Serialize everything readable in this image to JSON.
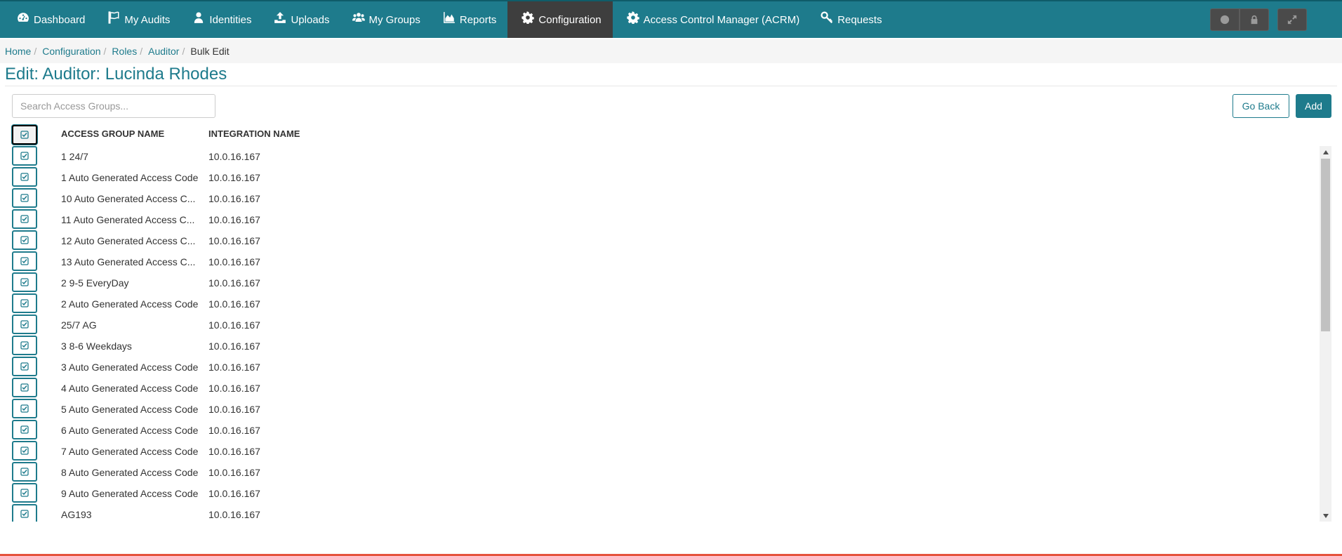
{
  "nav": {
    "items": [
      {
        "label": "Dashboard",
        "icon": "dashboard-icon"
      },
      {
        "label": "My Audits",
        "icon": "flag-icon"
      },
      {
        "label": "Identities",
        "icon": "user-icon"
      },
      {
        "label": "Uploads",
        "icon": "upload-icon"
      },
      {
        "label": "My Groups",
        "icon": "users-icon"
      },
      {
        "label": "Reports",
        "icon": "area-chart-icon"
      },
      {
        "label": "Configuration",
        "icon": "gear-icon",
        "active": true
      },
      {
        "label": "Access Control Manager (ACRM)",
        "icon": "gear-icon"
      },
      {
        "label": "Requests",
        "icon": "key-icon"
      }
    ],
    "right_buttons": [
      "globe-icon",
      "lock-icon",
      "expand-icon"
    ],
    "colors": {
      "bar": "#1e7b8c",
      "active": "#3e3e3e"
    }
  },
  "breadcrumb": [
    "Home",
    "Configuration",
    "Roles",
    "Auditor",
    "Bulk Edit"
  ],
  "page": {
    "title": "Edit: Auditor: Lucinda Rhodes",
    "search_placeholder": "Search Access Groups...",
    "go_back_label": "Go Back",
    "add_label": "Add"
  },
  "table": {
    "columns": [
      "ACCESS GROUP NAME",
      "INTEGRATION NAME"
    ],
    "rows": [
      {
        "name": "1 24/7",
        "integration": "10.0.16.167",
        "checked": true
      },
      {
        "name": "1 Auto Generated Access Code",
        "integration": "10.0.16.167",
        "checked": true
      },
      {
        "name": "10 Auto Generated Access C...",
        "integration": "10.0.16.167",
        "checked": true
      },
      {
        "name": "11 Auto Generated Access C...",
        "integration": "10.0.16.167",
        "checked": true
      },
      {
        "name": "12 Auto Generated Access C...",
        "integration": "10.0.16.167",
        "checked": true
      },
      {
        "name": "13 Auto Generated Access C...",
        "integration": "10.0.16.167",
        "checked": true
      },
      {
        "name": "2 9-5 EveryDay",
        "integration": "10.0.16.167",
        "checked": true
      },
      {
        "name": "2 Auto Generated Access Code",
        "integration": "10.0.16.167",
        "checked": true
      },
      {
        "name": "25/7 AG",
        "integration": "10.0.16.167",
        "checked": true
      },
      {
        "name": "3 8-6 Weekdays",
        "integration": "10.0.16.167",
        "checked": true
      },
      {
        "name": "3 Auto Generated Access Code",
        "integration": "10.0.16.167",
        "checked": true
      },
      {
        "name": "4 Auto Generated Access Code",
        "integration": "10.0.16.167",
        "checked": true
      },
      {
        "name": "5 Auto Generated Access Code",
        "integration": "10.0.16.167",
        "checked": true
      },
      {
        "name": "6 Auto Generated Access Code",
        "integration": "10.0.16.167",
        "checked": true
      },
      {
        "name": "7 Auto Generated Access Code",
        "integration": "10.0.16.167",
        "checked": true
      },
      {
        "name": "8 Auto Generated Access Code",
        "integration": "10.0.16.167",
        "checked": true
      },
      {
        "name": "9 Auto Generated Access Code",
        "integration": "10.0.16.167",
        "checked": true
      },
      {
        "name": "AG193",
        "integration": "10.0.16.167",
        "checked": true
      }
    ]
  }
}
